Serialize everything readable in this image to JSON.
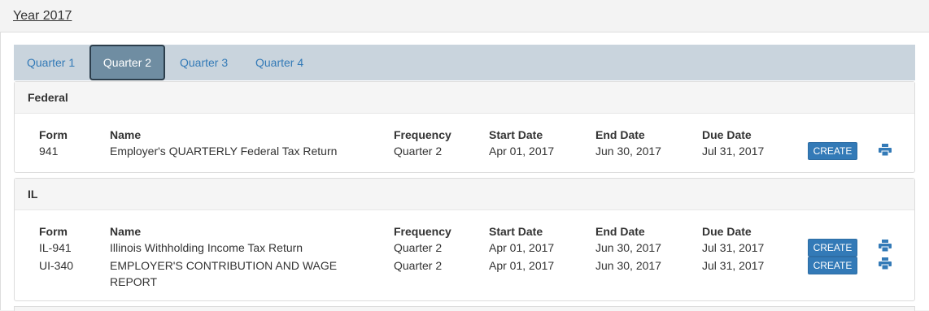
{
  "year": {
    "title": "Year 2017"
  },
  "tabs": [
    {
      "label": "Quarter 1",
      "active": false
    },
    {
      "label": "Quarter 2",
      "active": true
    },
    {
      "label": "Quarter 3",
      "active": false
    },
    {
      "label": "Quarter 4",
      "active": false
    }
  ],
  "columns": {
    "form": "Form",
    "name": "Name",
    "frequency": "Frequency",
    "start": "Start Date",
    "end": "End Date",
    "due": "Due Date"
  },
  "sections": [
    {
      "title": "Federal",
      "rows": [
        {
          "form": "941",
          "name": "Employer's QUARTERLY Federal Tax Return",
          "frequency": "Quarter 2",
          "start": "Apr 01, 2017",
          "end": "Jun 30, 2017",
          "due": "Jul 31, 2017",
          "action": "CREATE"
        }
      ]
    },
    {
      "title": "IL",
      "rows": [
        {
          "form": "IL-941",
          "name": "Illinois Withholding Income Tax Return",
          "frequency": "Quarter 2",
          "start": "Apr 01, 2017",
          "end": "Jun 30, 2017",
          "due": "Jul 31, 2017",
          "action": "CREATE"
        },
        {
          "form": "UI-340",
          "name": "EMPLOYER'S CONTRIBUTION AND WAGE",
          "name_line2": "REPORT",
          "frequency": "Quarter 2",
          "start": "Apr 01, 2017",
          "end": "Jun 30, 2017",
          "due": "Jul 31, 2017",
          "action": "CREATE"
        }
      ]
    }
  ],
  "icons": {
    "print": "printer-icon"
  },
  "colors": {
    "tabbar": "#c9d4dd",
    "active_tab": "#6f8da2",
    "link": "#337ab7",
    "button": "#337ab7"
  }
}
